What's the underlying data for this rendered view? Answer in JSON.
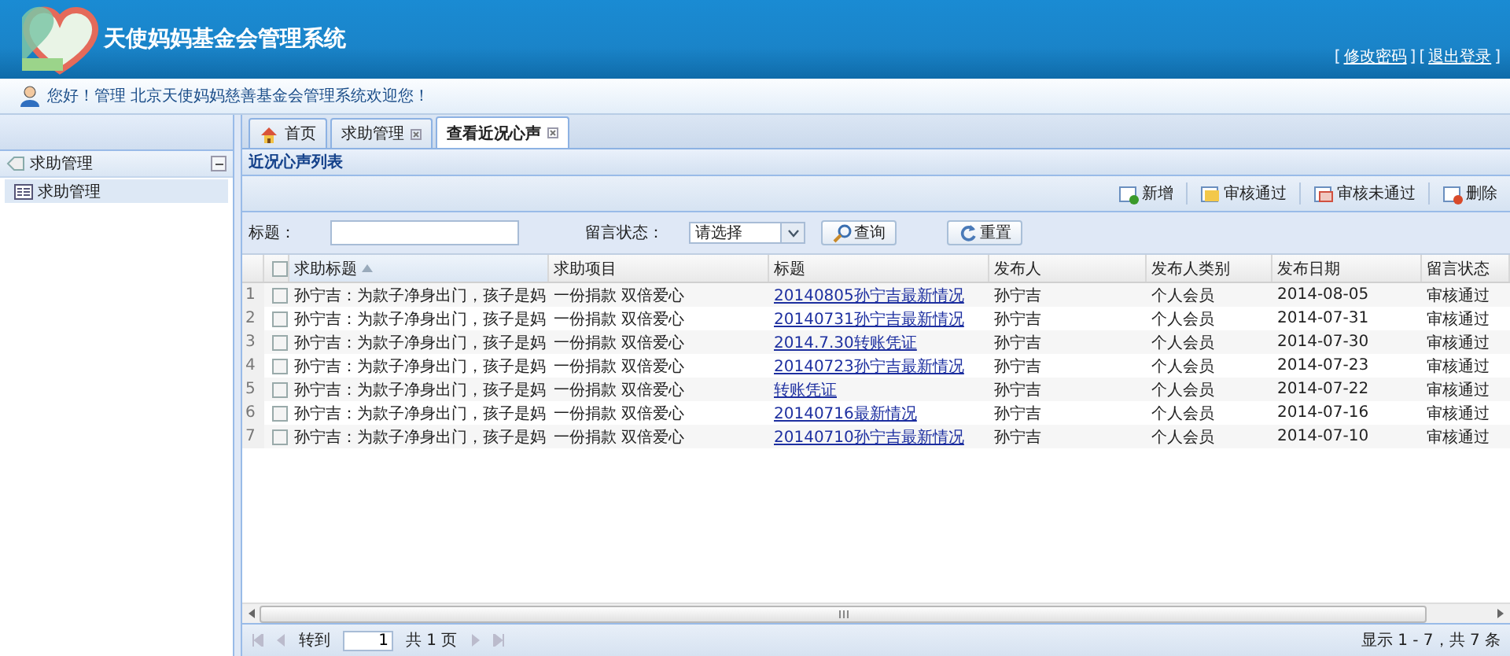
{
  "header": {
    "title": "天使妈妈基金会管理系统",
    "link_brackets": [
      "[",
      "]"
    ],
    "links": [
      "修改密码",
      "退出登录"
    ]
  },
  "welcome": {
    "greeting": "您好！管理 北京天使妈妈慈善基金会管理系统欢迎您！"
  },
  "tabs": [
    {
      "label": "首页",
      "kind": "home",
      "selected": false,
      "closable": false
    },
    {
      "label": "求助管理",
      "kind": "plain",
      "selected": false,
      "closable": true
    },
    {
      "label": "查看近况心声",
      "kind": "plain",
      "selected": true,
      "closable": true
    }
  ],
  "sidebar": {
    "sections": [
      {
        "title": "求助管理",
        "expanded": true,
        "items": [
          {
            "label": "求助管理",
            "selected": true
          }
        ]
      }
    ]
  },
  "panel": {
    "title": "近况心声列表",
    "toolbar": [
      {
        "label": "新增",
        "kind": "add"
      },
      {
        "label": "审核通过",
        "kind": "approve"
      },
      {
        "label": "审核未通过",
        "kind": "reject"
      },
      {
        "label": "删除",
        "kind": "delete"
      }
    ],
    "filters": [
      {
        "kind": "text",
        "label": "标题："
      },
      {
        "kind": "select",
        "label": "留言状态：",
        "value": "请选择"
      }
    ],
    "buttons": [
      {
        "label": "查询",
        "kind": "search"
      },
      {
        "label": "重置",
        "kind": "reset"
      }
    ],
    "table": {
      "all_checked": false,
      "columns": [
        {
          "label": "求助标题",
          "kind": "text",
          "sorted": true
        },
        {
          "label": "求助项目",
          "kind": "text",
          "sorted": false
        },
        {
          "label": "标题",
          "kind": "link",
          "sorted": false
        },
        {
          "label": "发布人",
          "kind": "text",
          "sorted": false
        },
        {
          "label": "发布人类别",
          "kind": "text",
          "sorted": false
        },
        {
          "label": "发布日期",
          "kind": "text",
          "sorted": false
        },
        {
          "label": "留言状态",
          "kind": "text",
          "sorted": false
        }
      ],
      "rows": [
        {
          "number": "1",
          "checked": false,
          "cells": [
            "孙宁吉：为款子净身出门，孩子是妈",
            "一份捐款 双倍爱心",
            "20140805孙宁吉最新情况",
            "孙宁吉",
            "个人会员",
            "2014-08-05",
            "审核通过"
          ]
        },
        {
          "number": "2",
          "checked": false,
          "cells": [
            "孙宁吉：为款子净身出门，孩子是妈",
            "一份捐款 双倍爱心",
            "20140731孙宁吉最新情况",
            "孙宁吉",
            "个人会员",
            "2014-07-31",
            "审核通过"
          ]
        },
        {
          "number": "3",
          "checked": false,
          "cells": [
            "孙宁吉：为款子净身出门，孩子是妈",
            "一份捐款 双倍爱心",
            "2014.7.30转账凭证",
            "孙宁吉",
            "个人会员",
            "2014-07-30",
            "审核通过"
          ]
        },
        {
          "number": "4",
          "checked": false,
          "cells": [
            "孙宁吉：为款子净身出门，孩子是妈",
            "一份捐款 双倍爱心",
            "20140723孙宁吉最新情况",
            "孙宁吉",
            "个人会员",
            "2014-07-23",
            "审核通过"
          ]
        },
        {
          "number": "5",
          "checked": false,
          "cells": [
            "孙宁吉：为款子净身出门，孩子是妈",
            "一份捐款 双倍爱心",
            "转账凭证",
            "孙宁吉",
            "个人会员",
            "2014-07-22",
            "审核通过"
          ]
        },
        {
          "number": "6",
          "checked": false,
          "cells": [
            "孙宁吉：为款子净身出门，孩子是妈",
            "一份捐款 双倍爱心",
            "20140716最新情况",
            "孙宁吉",
            "个人会员",
            "2014-07-16",
            "审核通过"
          ]
        },
        {
          "number": "7",
          "checked": false,
          "cells": [
            "孙宁吉：为款子净身出门，孩子是妈",
            "一份捐款 双倍爱心",
            "20140710孙宁吉最新情况",
            "孙宁吉",
            "个人会员",
            "2014-07-10",
            "审核通过"
          ]
        }
      ]
    },
    "pager": {
      "goto_label": "转到",
      "page": "1",
      "page_total": "共 1 页",
      "summary": "显示 1 - 7，共 7 条"
    }
  }
}
